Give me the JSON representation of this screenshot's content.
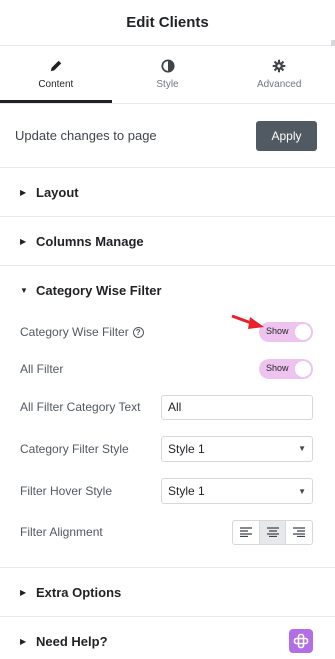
{
  "header": {
    "title": "Edit Clients"
  },
  "tabs": [
    {
      "label": "Content",
      "icon": "pencil-icon",
      "active": true
    },
    {
      "label": "Style",
      "icon": "half-circle-icon",
      "active": false
    },
    {
      "label": "Advanced",
      "icon": "gear-icon",
      "active": false
    }
  ],
  "update": {
    "text": "Update changes to page",
    "button": "Apply"
  },
  "sections": {
    "layout": "Layout",
    "columns": "Columns Manage",
    "category": "Category Wise Filter",
    "extra": "Extra Options",
    "help": "Need Help?"
  },
  "controls": {
    "category_filter_label": "Category Wise Filter",
    "category_filter_toggle": "Show",
    "all_filter_label": "All Filter",
    "all_filter_toggle": "Show",
    "all_filter_text_label": "All Filter Category Text",
    "all_filter_text_value": "All",
    "category_style_label": "Category Filter Style",
    "category_style_value": "Style 1",
    "hover_style_label": "Filter Hover Style",
    "hover_style_value": "Style 1",
    "alignment_label": "Filter Alignment",
    "alignment_value": "center"
  },
  "colors": {
    "accent_toggle": "#eec3f0",
    "apply_button": "#515962",
    "help_badge": "#b36ee6",
    "annotation_arrow": "#e8202a"
  }
}
